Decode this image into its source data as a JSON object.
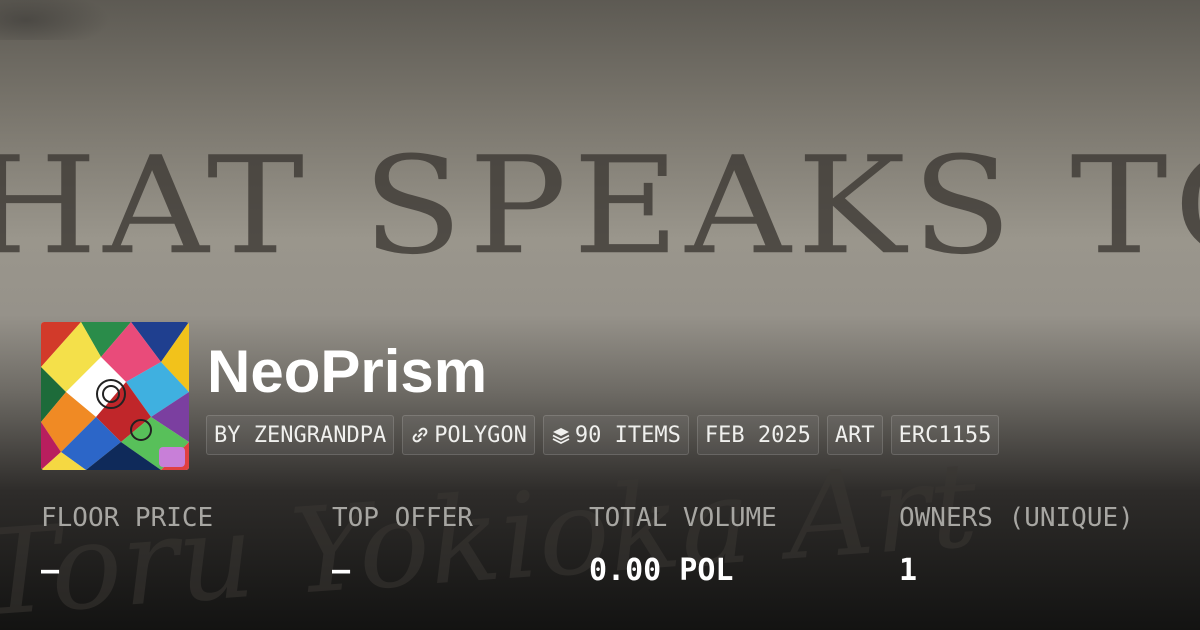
{
  "banner": {
    "headline": "HAT SPEAKS TO T",
    "script": "Toru Yokioka Art"
  },
  "collection": {
    "name": "NeoPrism",
    "badges": [
      {
        "label": "BY ZENGRANDPA",
        "icon": ""
      },
      {
        "label": "POLYGON",
        "icon": "link-icon"
      },
      {
        "label": "90 ITEMS",
        "icon": "layers-icon"
      },
      {
        "label": "FEB 2025",
        "icon": ""
      },
      {
        "label": "ART",
        "icon": ""
      },
      {
        "label": "ERC1155",
        "icon": ""
      }
    ]
  },
  "stats": [
    {
      "label": "FLOOR PRICE",
      "value": "–"
    },
    {
      "label": "TOP OFFER",
      "value": "–"
    },
    {
      "label": "TOTAL VOLUME",
      "value": "0.00 POL"
    },
    {
      "label": "OWNERS (UNIQUE)",
      "value": "1"
    }
  ],
  "colors": {
    "text_primary": "#ffffff",
    "text_muted": "#a7a6a2"
  }
}
